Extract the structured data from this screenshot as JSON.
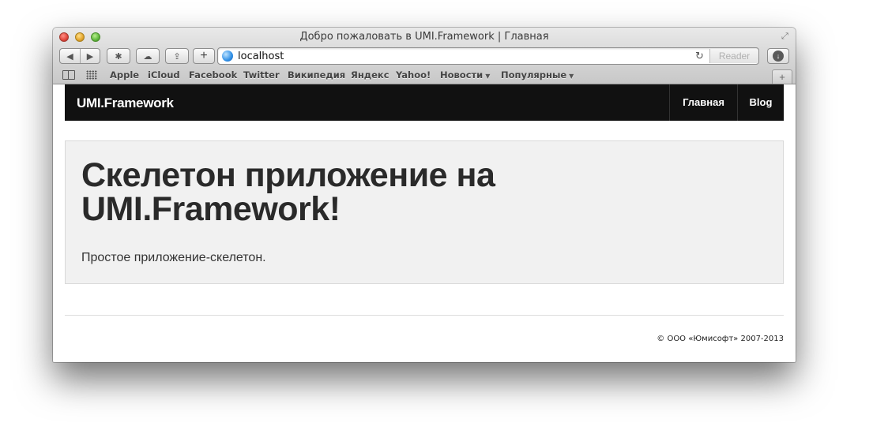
{
  "window": {
    "title": "Добро пожаловать в UMI.Framework | Главная"
  },
  "toolbar": {
    "back_icon": "back-arrow",
    "forward_icon": "forward-arrow",
    "url": "localhost",
    "reader_label": "Reader"
  },
  "bookmarks": {
    "items": [
      {
        "label": "Apple"
      },
      {
        "label": "iCloud"
      },
      {
        "label": "Facebook"
      },
      {
        "label": "Twitter"
      },
      {
        "label": "Википедия"
      },
      {
        "label": "Яндекс"
      },
      {
        "label": "Yahoo!"
      },
      {
        "label": "Новости"
      },
      {
        "label": "Популярные"
      }
    ]
  },
  "site": {
    "brand": "UMI.Framework",
    "nav": [
      {
        "label": "Главная"
      },
      {
        "label": "Blog"
      }
    ]
  },
  "hero": {
    "title": "Скелетон приложение на UMI.Framework!",
    "text": "Простое приложение-скелетон."
  },
  "footer": {
    "copyright": "© ООО «Юмисофт» 2007-2013"
  },
  "colors": {
    "navbar_bg": "#111111",
    "jumbotron_bg": "#f1f1f1"
  }
}
